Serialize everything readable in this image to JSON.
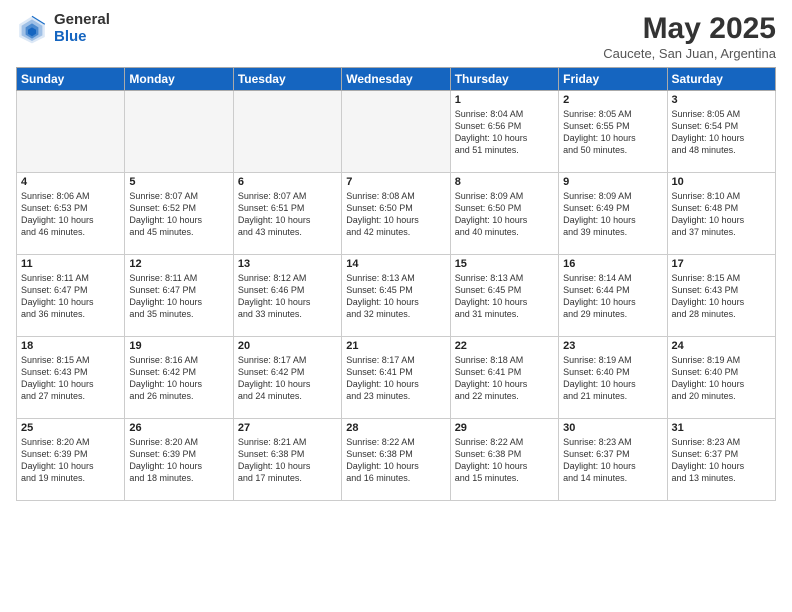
{
  "header": {
    "logo_general": "General",
    "logo_blue": "Blue",
    "title": "May 2025",
    "subtitle": "Caucete, San Juan, Argentina"
  },
  "weekdays": [
    "Sunday",
    "Monday",
    "Tuesday",
    "Wednesday",
    "Thursday",
    "Friday",
    "Saturday"
  ],
  "weeks": [
    [
      {
        "day": "",
        "info": ""
      },
      {
        "day": "",
        "info": ""
      },
      {
        "day": "",
        "info": ""
      },
      {
        "day": "",
        "info": ""
      },
      {
        "day": "1",
        "info": "Sunrise: 8:04 AM\nSunset: 6:56 PM\nDaylight: 10 hours\nand 51 minutes."
      },
      {
        "day": "2",
        "info": "Sunrise: 8:05 AM\nSunset: 6:55 PM\nDaylight: 10 hours\nand 50 minutes."
      },
      {
        "day": "3",
        "info": "Sunrise: 8:05 AM\nSunset: 6:54 PM\nDaylight: 10 hours\nand 48 minutes."
      }
    ],
    [
      {
        "day": "4",
        "info": "Sunrise: 8:06 AM\nSunset: 6:53 PM\nDaylight: 10 hours\nand 46 minutes."
      },
      {
        "day": "5",
        "info": "Sunrise: 8:07 AM\nSunset: 6:52 PM\nDaylight: 10 hours\nand 45 minutes."
      },
      {
        "day": "6",
        "info": "Sunrise: 8:07 AM\nSunset: 6:51 PM\nDaylight: 10 hours\nand 43 minutes."
      },
      {
        "day": "7",
        "info": "Sunrise: 8:08 AM\nSunset: 6:50 PM\nDaylight: 10 hours\nand 42 minutes."
      },
      {
        "day": "8",
        "info": "Sunrise: 8:09 AM\nSunset: 6:50 PM\nDaylight: 10 hours\nand 40 minutes."
      },
      {
        "day": "9",
        "info": "Sunrise: 8:09 AM\nSunset: 6:49 PM\nDaylight: 10 hours\nand 39 minutes."
      },
      {
        "day": "10",
        "info": "Sunrise: 8:10 AM\nSunset: 6:48 PM\nDaylight: 10 hours\nand 37 minutes."
      }
    ],
    [
      {
        "day": "11",
        "info": "Sunrise: 8:11 AM\nSunset: 6:47 PM\nDaylight: 10 hours\nand 36 minutes."
      },
      {
        "day": "12",
        "info": "Sunrise: 8:11 AM\nSunset: 6:47 PM\nDaylight: 10 hours\nand 35 minutes."
      },
      {
        "day": "13",
        "info": "Sunrise: 8:12 AM\nSunset: 6:46 PM\nDaylight: 10 hours\nand 33 minutes."
      },
      {
        "day": "14",
        "info": "Sunrise: 8:13 AM\nSunset: 6:45 PM\nDaylight: 10 hours\nand 32 minutes."
      },
      {
        "day": "15",
        "info": "Sunrise: 8:13 AM\nSunset: 6:45 PM\nDaylight: 10 hours\nand 31 minutes."
      },
      {
        "day": "16",
        "info": "Sunrise: 8:14 AM\nSunset: 6:44 PM\nDaylight: 10 hours\nand 29 minutes."
      },
      {
        "day": "17",
        "info": "Sunrise: 8:15 AM\nSunset: 6:43 PM\nDaylight: 10 hours\nand 28 minutes."
      }
    ],
    [
      {
        "day": "18",
        "info": "Sunrise: 8:15 AM\nSunset: 6:43 PM\nDaylight: 10 hours\nand 27 minutes."
      },
      {
        "day": "19",
        "info": "Sunrise: 8:16 AM\nSunset: 6:42 PM\nDaylight: 10 hours\nand 26 minutes."
      },
      {
        "day": "20",
        "info": "Sunrise: 8:17 AM\nSunset: 6:42 PM\nDaylight: 10 hours\nand 24 minutes."
      },
      {
        "day": "21",
        "info": "Sunrise: 8:17 AM\nSunset: 6:41 PM\nDaylight: 10 hours\nand 23 minutes."
      },
      {
        "day": "22",
        "info": "Sunrise: 8:18 AM\nSunset: 6:41 PM\nDaylight: 10 hours\nand 22 minutes."
      },
      {
        "day": "23",
        "info": "Sunrise: 8:19 AM\nSunset: 6:40 PM\nDaylight: 10 hours\nand 21 minutes."
      },
      {
        "day": "24",
        "info": "Sunrise: 8:19 AM\nSunset: 6:40 PM\nDaylight: 10 hours\nand 20 minutes."
      }
    ],
    [
      {
        "day": "25",
        "info": "Sunrise: 8:20 AM\nSunset: 6:39 PM\nDaylight: 10 hours\nand 19 minutes."
      },
      {
        "day": "26",
        "info": "Sunrise: 8:20 AM\nSunset: 6:39 PM\nDaylight: 10 hours\nand 18 minutes."
      },
      {
        "day": "27",
        "info": "Sunrise: 8:21 AM\nSunset: 6:38 PM\nDaylight: 10 hours\nand 17 minutes."
      },
      {
        "day": "28",
        "info": "Sunrise: 8:22 AM\nSunset: 6:38 PM\nDaylight: 10 hours\nand 16 minutes."
      },
      {
        "day": "29",
        "info": "Sunrise: 8:22 AM\nSunset: 6:38 PM\nDaylight: 10 hours\nand 15 minutes."
      },
      {
        "day": "30",
        "info": "Sunrise: 8:23 AM\nSunset: 6:37 PM\nDaylight: 10 hours\nand 14 minutes."
      },
      {
        "day": "31",
        "info": "Sunrise: 8:23 AM\nSunset: 6:37 PM\nDaylight: 10 hours\nand 13 minutes."
      }
    ]
  ]
}
